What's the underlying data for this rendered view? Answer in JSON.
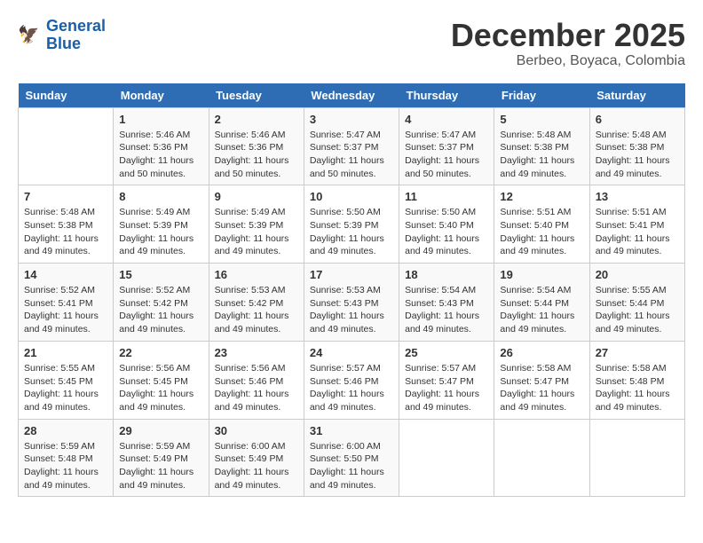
{
  "header": {
    "logo_line1": "General",
    "logo_line2": "Blue",
    "month": "December 2025",
    "location": "Berbeo, Boyaca, Colombia"
  },
  "days_of_week": [
    "Sunday",
    "Monday",
    "Tuesday",
    "Wednesday",
    "Thursday",
    "Friday",
    "Saturday"
  ],
  "weeks": [
    [
      {
        "day": "",
        "info": ""
      },
      {
        "day": "1",
        "info": "Sunrise: 5:46 AM\nSunset: 5:36 PM\nDaylight: 11 hours\nand 50 minutes."
      },
      {
        "day": "2",
        "info": "Sunrise: 5:46 AM\nSunset: 5:36 PM\nDaylight: 11 hours\nand 50 minutes."
      },
      {
        "day": "3",
        "info": "Sunrise: 5:47 AM\nSunset: 5:37 PM\nDaylight: 11 hours\nand 50 minutes."
      },
      {
        "day": "4",
        "info": "Sunrise: 5:47 AM\nSunset: 5:37 PM\nDaylight: 11 hours\nand 50 minutes."
      },
      {
        "day": "5",
        "info": "Sunrise: 5:48 AM\nSunset: 5:38 PM\nDaylight: 11 hours\nand 49 minutes."
      },
      {
        "day": "6",
        "info": "Sunrise: 5:48 AM\nSunset: 5:38 PM\nDaylight: 11 hours\nand 49 minutes."
      }
    ],
    [
      {
        "day": "7",
        "info": "Sunrise: 5:48 AM\nSunset: 5:38 PM\nDaylight: 11 hours\nand 49 minutes."
      },
      {
        "day": "8",
        "info": "Sunrise: 5:49 AM\nSunset: 5:39 PM\nDaylight: 11 hours\nand 49 minutes."
      },
      {
        "day": "9",
        "info": "Sunrise: 5:49 AM\nSunset: 5:39 PM\nDaylight: 11 hours\nand 49 minutes."
      },
      {
        "day": "10",
        "info": "Sunrise: 5:50 AM\nSunset: 5:39 PM\nDaylight: 11 hours\nand 49 minutes."
      },
      {
        "day": "11",
        "info": "Sunrise: 5:50 AM\nSunset: 5:40 PM\nDaylight: 11 hours\nand 49 minutes."
      },
      {
        "day": "12",
        "info": "Sunrise: 5:51 AM\nSunset: 5:40 PM\nDaylight: 11 hours\nand 49 minutes."
      },
      {
        "day": "13",
        "info": "Sunrise: 5:51 AM\nSunset: 5:41 PM\nDaylight: 11 hours\nand 49 minutes."
      }
    ],
    [
      {
        "day": "14",
        "info": "Sunrise: 5:52 AM\nSunset: 5:41 PM\nDaylight: 11 hours\nand 49 minutes."
      },
      {
        "day": "15",
        "info": "Sunrise: 5:52 AM\nSunset: 5:42 PM\nDaylight: 11 hours\nand 49 minutes."
      },
      {
        "day": "16",
        "info": "Sunrise: 5:53 AM\nSunset: 5:42 PM\nDaylight: 11 hours\nand 49 minutes."
      },
      {
        "day": "17",
        "info": "Sunrise: 5:53 AM\nSunset: 5:43 PM\nDaylight: 11 hours\nand 49 minutes."
      },
      {
        "day": "18",
        "info": "Sunrise: 5:54 AM\nSunset: 5:43 PM\nDaylight: 11 hours\nand 49 minutes."
      },
      {
        "day": "19",
        "info": "Sunrise: 5:54 AM\nSunset: 5:44 PM\nDaylight: 11 hours\nand 49 minutes."
      },
      {
        "day": "20",
        "info": "Sunrise: 5:55 AM\nSunset: 5:44 PM\nDaylight: 11 hours\nand 49 minutes."
      }
    ],
    [
      {
        "day": "21",
        "info": "Sunrise: 5:55 AM\nSunset: 5:45 PM\nDaylight: 11 hours\nand 49 minutes."
      },
      {
        "day": "22",
        "info": "Sunrise: 5:56 AM\nSunset: 5:45 PM\nDaylight: 11 hours\nand 49 minutes."
      },
      {
        "day": "23",
        "info": "Sunrise: 5:56 AM\nSunset: 5:46 PM\nDaylight: 11 hours\nand 49 minutes."
      },
      {
        "day": "24",
        "info": "Sunrise: 5:57 AM\nSunset: 5:46 PM\nDaylight: 11 hours\nand 49 minutes."
      },
      {
        "day": "25",
        "info": "Sunrise: 5:57 AM\nSunset: 5:47 PM\nDaylight: 11 hours\nand 49 minutes."
      },
      {
        "day": "26",
        "info": "Sunrise: 5:58 AM\nSunset: 5:47 PM\nDaylight: 11 hours\nand 49 minutes."
      },
      {
        "day": "27",
        "info": "Sunrise: 5:58 AM\nSunset: 5:48 PM\nDaylight: 11 hours\nand 49 minutes."
      }
    ],
    [
      {
        "day": "28",
        "info": "Sunrise: 5:59 AM\nSunset: 5:48 PM\nDaylight: 11 hours\nand 49 minutes."
      },
      {
        "day": "29",
        "info": "Sunrise: 5:59 AM\nSunset: 5:49 PM\nDaylight: 11 hours\nand 49 minutes."
      },
      {
        "day": "30",
        "info": "Sunrise: 6:00 AM\nSunset: 5:49 PM\nDaylight: 11 hours\nand 49 minutes."
      },
      {
        "day": "31",
        "info": "Sunrise: 6:00 AM\nSunset: 5:50 PM\nDaylight: 11 hours\nand 49 minutes."
      },
      {
        "day": "",
        "info": ""
      },
      {
        "day": "",
        "info": ""
      },
      {
        "day": "",
        "info": ""
      }
    ]
  ]
}
